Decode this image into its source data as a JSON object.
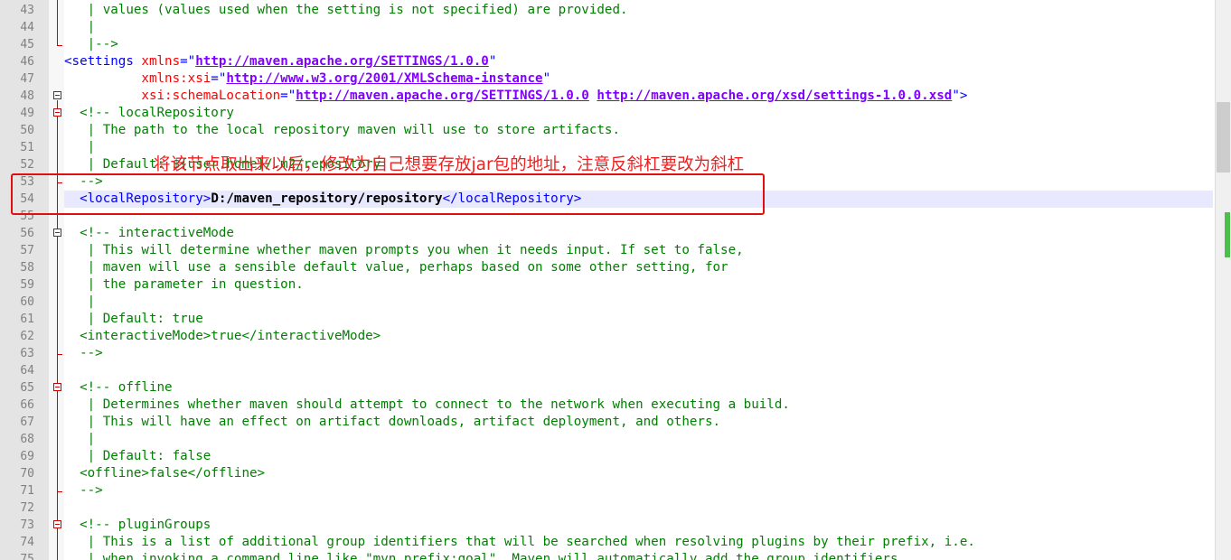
{
  "editor": {
    "line_numbers": [
      "43",
      "44",
      "45",
      "46",
      "47",
      "48",
      "49",
      "50",
      "51",
      "52",
      "53",
      "54",
      "55",
      "56",
      "57",
      "58",
      "59",
      "60",
      "61",
      "62",
      "63",
      "64",
      "65",
      "66",
      "67",
      "68",
      "69",
      "70",
      "71",
      "72",
      "73",
      "74",
      "75"
    ],
    "lines": {
      "l43": {
        "text": "| values (values used when the setting is not specified) are provided."
      },
      "l44": {
        "text": "|"
      },
      "l45": {
        "text": "|-->"
      },
      "l46": {
        "tag_open": "<settings",
        "attr": "xmlns",
        "eq": "=\"",
        "url": "http://maven.apache.org/SETTINGS/1.0.0",
        "q": "\""
      },
      "l47": {
        "attr": "xmlns:xsi",
        "eq": "=\"",
        "url": "http://www.w3.org/2001/XMLSchema-instance",
        "q": "\""
      },
      "l48": {
        "attr": "xsi:schemaLocation",
        "eq": "=\"",
        "url1": "http://maven.apache.org/SETTINGS/1.0.0",
        "sp": " ",
        "url2": "http://maven.apache.org/xsd/settings-1.0.0.xsd",
        "end": "\">"
      },
      "l49": {
        "text": "<!-- localRepository"
      },
      "l50": {
        "text": "| The path to the local repository maven will use to store artifacts."
      },
      "l51": {
        "text": "|"
      },
      "l52": {
        "text": "| Default: ${user.home}/.m2/repository"
      },
      "l53": {
        "text": "-->"
      },
      "l54": {
        "open": "<localRepository>",
        "value": "D:/maven_repository/repository",
        "close": "</localRepository>"
      },
      "l55": {
        "text": ""
      },
      "l56": {
        "text": "<!-- interactiveMode"
      },
      "l57": {
        "text": "| This will determine whether maven prompts you when it needs input. If set to false,"
      },
      "l58": {
        "text": "| maven will use a sensible default value, perhaps based on some other setting, for"
      },
      "l59": {
        "text": "| the parameter in question."
      },
      "l60": {
        "text": "|"
      },
      "l61": {
        "text": "| Default: true"
      },
      "l62": {
        "text": "<interactiveMode>true</interactiveMode>"
      },
      "l63": {
        "text": "-->"
      },
      "l64": {
        "text": ""
      },
      "l65": {
        "text": "<!-- offline"
      },
      "l66": {
        "text": "| Determines whether maven should attempt to connect to the network when executing a build."
      },
      "l67": {
        "text": "| This will have an effect on artifact downloads, artifact deployment, and others."
      },
      "l68": {
        "text": "|"
      },
      "l69": {
        "text": "| Default: false"
      },
      "l70": {
        "text": "<offline>false</offline>"
      },
      "l71": {
        "text": "-->"
      },
      "l72": {
        "text": ""
      },
      "l73": {
        "text": "<!-- pluginGroups"
      },
      "l74": {
        "text": "| This is a list of additional group identifiers that will be searched when resolving plugins by their prefix, i.e."
      },
      "l75": {
        "text": "| when invoking a command line like \"mvn prefix:goal\". Maven will automatically add the group identifiers"
      }
    }
  },
  "annotation": {
    "text": "将该节点取出来以后，修改为自己想要存放jar包的地址，注意反斜杠要改为斜杠"
  },
  "colors": {
    "comment": "#008000",
    "tag": "#0000ff",
    "attribute": "#ff0000",
    "url": "#8000ff",
    "annotation": "#ee2020",
    "current_line": "#e8e8ff"
  },
  "icons": [
    "fold-minus-icon"
  ]
}
